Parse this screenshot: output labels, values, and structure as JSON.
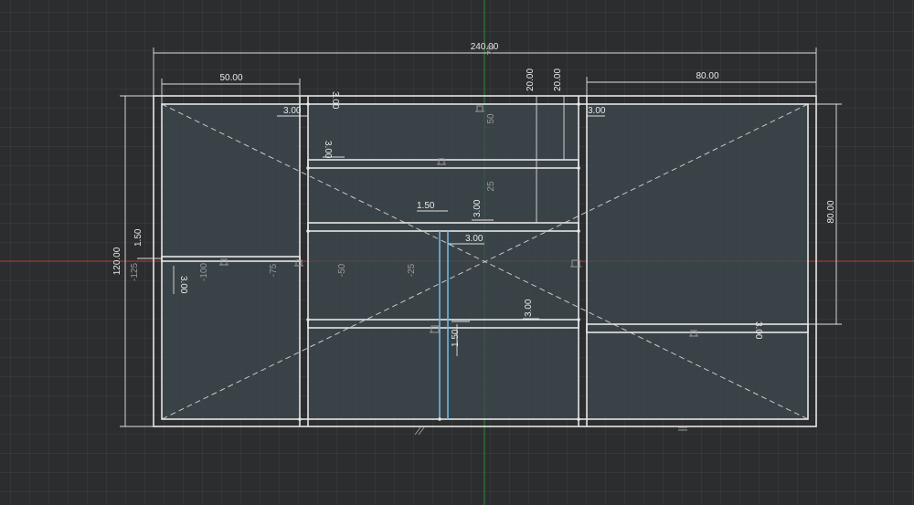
{
  "viewport": {
    "background": "#2c2d2f",
    "x_axis_color": "#b03a2e",
    "y_axis_color": "#2e8b3a",
    "geometry_color": "#e6e6e6",
    "panel_fill": "#3e4a50",
    "selection_color": "#6fb7e6"
  },
  "dimensions": {
    "overall_width": "240.00",
    "overall_height": "120.00",
    "left_bay_width": "50.00",
    "right_bay_width": "80.00",
    "right_bay_height": "80.00",
    "frame_left_offset": "3.00",
    "frame_top_offset": "3.00",
    "frame_right_offset": "3.00",
    "top_rail_a": "20.00",
    "top_rail_b": "20.00",
    "shelf_top_thickness": "3.00",
    "shelf_mid_thickness": "3.00",
    "shelf_low_thickness": "3.00",
    "center_post_offset": "1.50",
    "center_post_gap": "3.00",
    "left_shelf_a": "1.50",
    "left_shelf_b": "3.00",
    "center_post_bottom": "1.50",
    "right_shelf_thickness": "3.00"
  },
  "axis_ticks": {
    "x": [
      "-125",
      "-100",
      "-75",
      "-50",
      "-25"
    ],
    "y": [
      "75",
      "50",
      "25"
    ]
  }
}
